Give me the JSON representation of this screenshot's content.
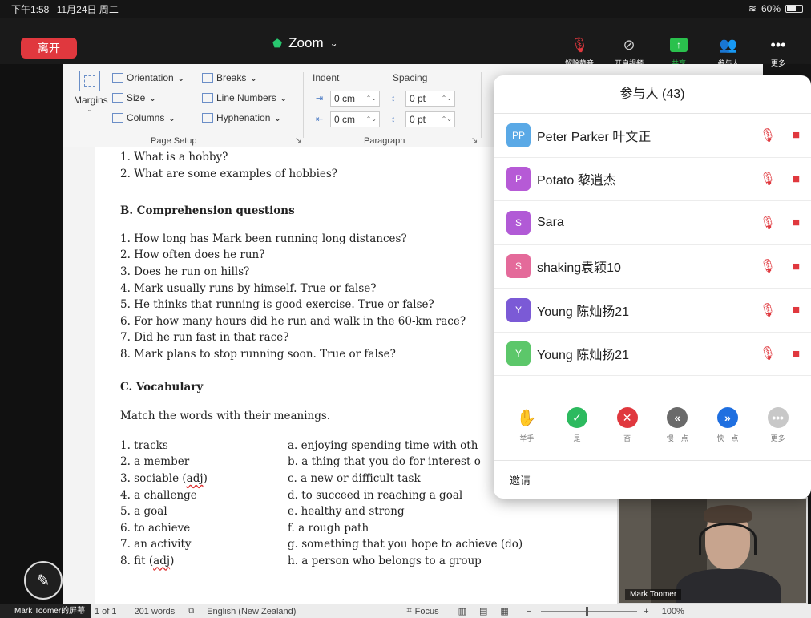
{
  "statusbar": {
    "time": "下午1:58",
    "date": "11月24日 周二",
    "battery": "60%"
  },
  "zoom": {
    "leave_label": "离开",
    "title": "Zoom",
    "toolbar": [
      {
        "icon": "mic-off-icon",
        "label": "解除静音"
      },
      {
        "icon": "video-off-icon",
        "label": "开启视频"
      },
      {
        "icon": "share-icon",
        "label": "共享"
      },
      {
        "icon": "participants-icon",
        "label": "参与人"
      },
      {
        "icon": "more-icon",
        "label": "更多"
      }
    ]
  },
  "ribbon": {
    "margins": "Margins",
    "orientation": "Orientation",
    "size": "Size",
    "columns": "Columns",
    "breaks": "Breaks",
    "line_numbers": "Line Numbers",
    "hyphenation": "Hyphenation",
    "page_setup": "Page Setup",
    "indent": "Indent",
    "spacing": "Spacing",
    "indent_left": "0 cm",
    "indent_right": "0 cm",
    "spacing_before": "0 pt",
    "spacing_after": "0 pt",
    "paragraph": "Paragraph"
  },
  "doc": {
    "intro": [
      "1. What is a hobby?",
      "2. What are some examples of hobbies?"
    ],
    "section_b": "B. Comprehension questions",
    "questions": [
      "1. How long has Mark been running long distances?",
      "2. How often does he run?",
      "3. Does he run on hills?",
      "4. Mark usually runs by himself. True or false?",
      "5. He thinks that running is good exercise. True or false?",
      "6. For how many hours did he run and walk in the 60-km race?",
      "7. Did he run fast in that race?",
      "8. Mark plans to stop running soon. True or false?"
    ],
    "section_c": "C. Vocabulary",
    "instruction": "Match the words with their meanings.",
    "words": [
      "1. tracks",
      "2. a member",
      "3. sociable (adj)",
      "4. a challenge",
      "5. a goal",
      "6. to achieve",
      "7. an activity",
      "8. fit (adj)"
    ],
    "meanings": [
      "a. enjoying spending time with oth",
      "b. a thing that you do for interest o",
      "c. a new or difficult task",
      "d. to succeed in reaching a goal",
      "e. healthy and strong",
      "f. a rough path",
      "g. something that you hope to achieve (do)",
      "h. a person who belongs to a group"
    ]
  },
  "wordstatus": {
    "screen_label": "Mark Toomer的屏幕",
    "page": "1 of 1",
    "words": "201 words",
    "language": "English (New Zealand)",
    "focus": "Focus",
    "zoom": "100%"
  },
  "participants": {
    "title": "参与人 (43)",
    "list": [
      {
        "initials": "PP",
        "name": "Peter Parker 叶文正",
        "color": "#5aa9e6"
      },
      {
        "initials": "P",
        "name": "Potato  黎逍杰",
        "color": "#b65ad6"
      },
      {
        "initials": "S",
        "name": "Sara",
        "color": "#b15ad6"
      },
      {
        "initials": "S",
        "name": "shaking袁颖10",
        "color": "#e46a9a"
      },
      {
        "initials": "Y",
        "name": "Young 陈灿扬21",
        "color": "#7b5ad6"
      },
      {
        "initials": "Y",
        "name": "Young 陈灿扬21",
        "color": "#5cc76a"
      }
    ],
    "reactions": [
      {
        "icon": "raise-hand-icon",
        "label": "举手",
        "color": "#1f6fe0"
      },
      {
        "icon": "yes-icon",
        "label": "是",
        "color": "#2dba5f"
      },
      {
        "icon": "no-icon",
        "label": "否",
        "color": "#e0383e"
      },
      {
        "icon": "slower-icon",
        "label": "慢一点",
        "color": "#6a6a6a"
      },
      {
        "icon": "faster-icon",
        "label": "快一点",
        "color": "#1f6fe0"
      },
      {
        "icon": "more-icon",
        "label": "更多",
        "color": "#c8c8c8"
      }
    ],
    "invite": "邀请"
  },
  "video": {
    "name": "Mark Toomer"
  }
}
